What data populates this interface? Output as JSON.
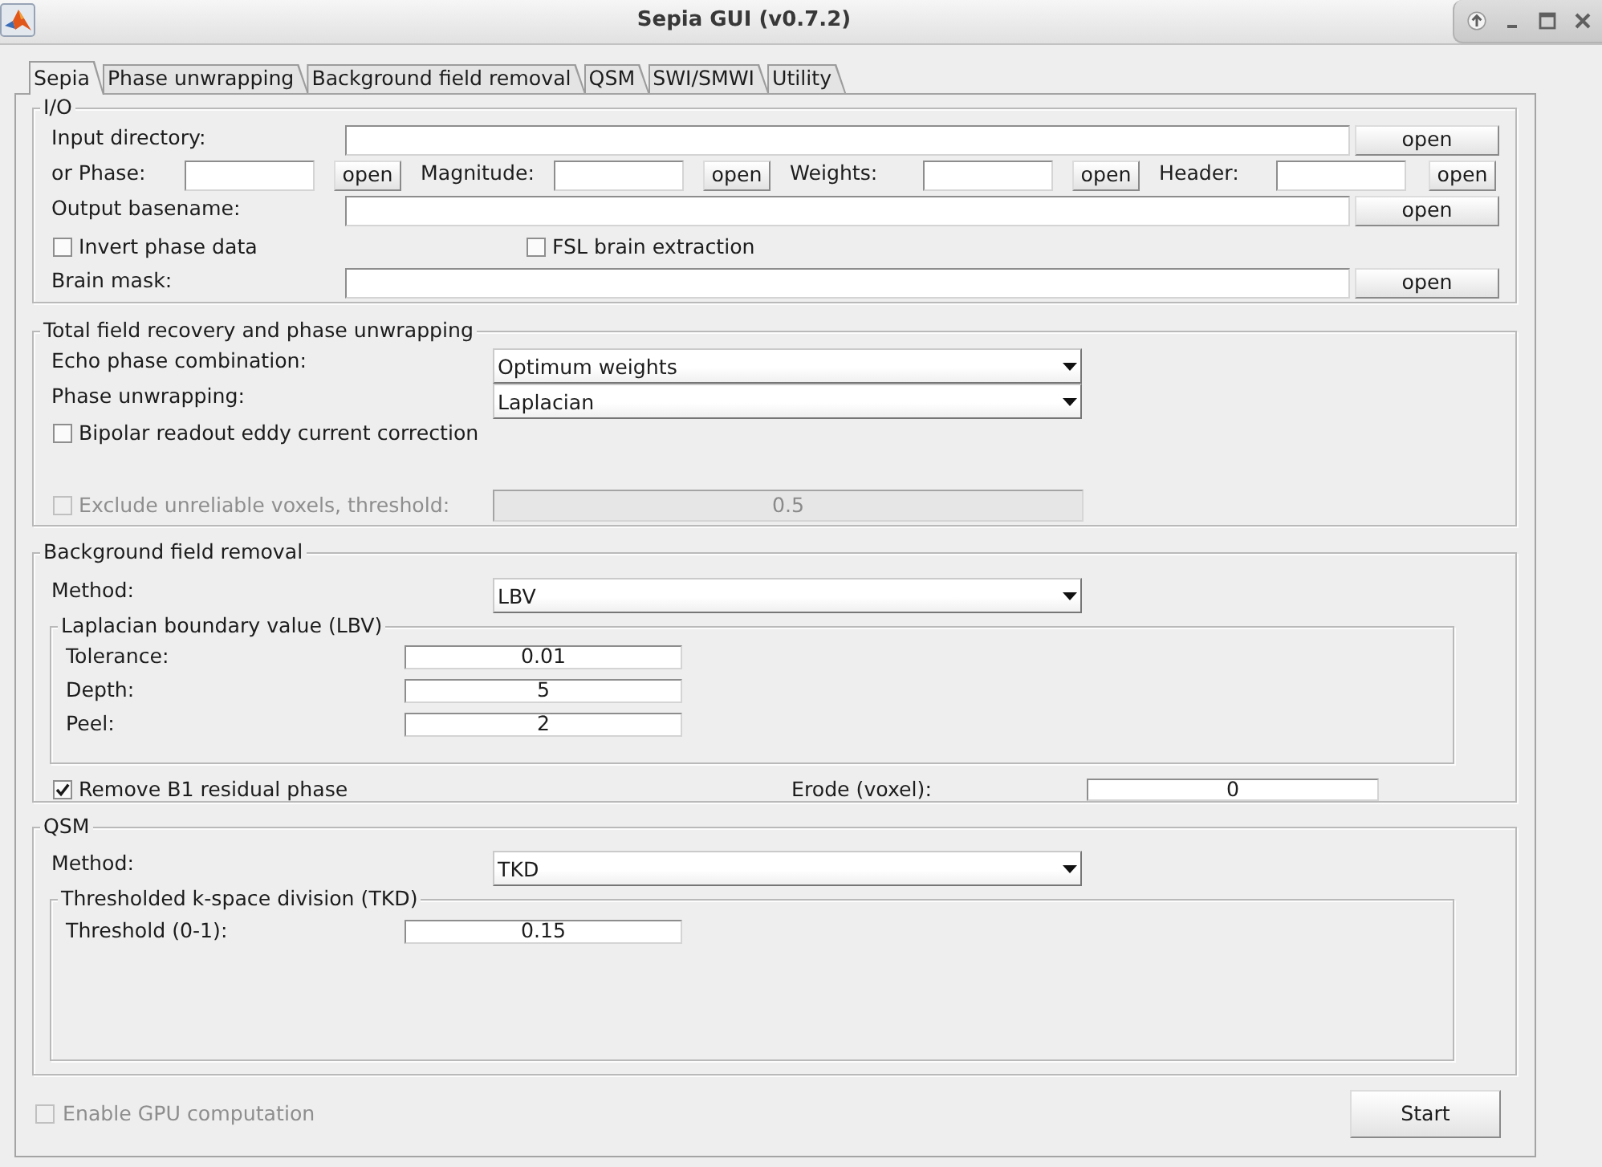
{
  "window": {
    "title": "Sepia GUI (v0.7.2)"
  },
  "tabs": [
    {
      "label": "Sepia",
      "selected": true
    },
    {
      "label": "Phase unwrapping",
      "selected": false
    },
    {
      "label": "Background field removal",
      "selected": false
    },
    {
      "label": "QSM",
      "selected": false
    },
    {
      "label": "SWI/SMWI",
      "selected": false
    },
    {
      "label": "Utility",
      "selected": false
    }
  ],
  "panels": [
    {
      "title": "I/O",
      "rows": [
        {
          "kind": "path",
          "label": "Input directory:",
          "button": "open"
        },
        {
          "kind": "files",
          "items": [
            {
              "label": "or Phase:",
              "button": "open"
            },
            {
              "label": "Magnitude:",
              "button": "open"
            },
            {
              "label": "Weights:",
              "button": "open"
            },
            {
              "label": "Header:",
              "button": "open"
            }
          ]
        },
        {
          "kind": "path",
          "label": "Output basename:",
          "button": "open"
        },
        {
          "kind": "checks",
          "items": [
            {
              "label": "Invert phase data",
              "checked": false,
              "disabled": false
            },
            {
              "label": "FSL brain extraction",
              "checked": false,
              "disabled": false
            }
          ]
        },
        {
          "kind": "path",
          "label": "Brain mask:",
          "button": "open"
        }
      ]
    },
    {
      "title": "Total field recovery and phase unwrapping",
      "rows": [
        {
          "kind": "dropdown",
          "label": "Echo phase combination:",
          "value": "Optimum weights"
        },
        {
          "kind": "dropdown",
          "label": "Phase unwrapping:",
          "value": "Laplacian"
        },
        {
          "kind": "checks",
          "items": [
            {
              "label": "Bipolar readout eddy current correction",
              "checked": false,
              "disabled": false
            }
          ]
        },
        {
          "kind": "check_field",
          "checkbox": {
            "label": "Exclude unreliable voxels, threshold:",
            "checked": false,
            "disabled": true
          },
          "field": {
            "value": "0.5",
            "disabled": true
          }
        }
      ]
    },
    {
      "title": "Background field removal",
      "rows": [
        {
          "kind": "dropdown",
          "label": "Method:",
          "value": "LBV"
        },
        {
          "kind": "subpanel",
          "title": "Laplacian boundary value (LBV)",
          "rows": [
            {
              "kind": "number",
              "label": "Tolerance:",
              "value": "0.01"
            },
            {
              "kind": "number",
              "label": "Depth:",
              "value": "5"
            },
            {
              "kind": "number",
              "label": "Peel:",
              "value": "2"
            }
          ]
        },
        {
          "kind": "check_number",
          "checkbox": {
            "label": "Remove B1 residual phase",
            "checked": true,
            "disabled": false
          },
          "label": "Erode (voxel):",
          "value": "0"
        }
      ]
    },
    {
      "title": "QSM",
      "rows": [
        {
          "kind": "dropdown",
          "label": "Method:",
          "value": "TKD"
        },
        {
          "kind": "subpanel",
          "title": "Thresholded k-space division (TKD)",
          "rows": [
            {
              "kind": "number",
              "label": "Threshold (0-1):",
              "value": "0.15"
            }
          ]
        }
      ]
    }
  ],
  "footer": {
    "checkbox": {
      "label": "Enable GPU computation",
      "checked": false,
      "disabled": true
    },
    "button": "Start"
  }
}
